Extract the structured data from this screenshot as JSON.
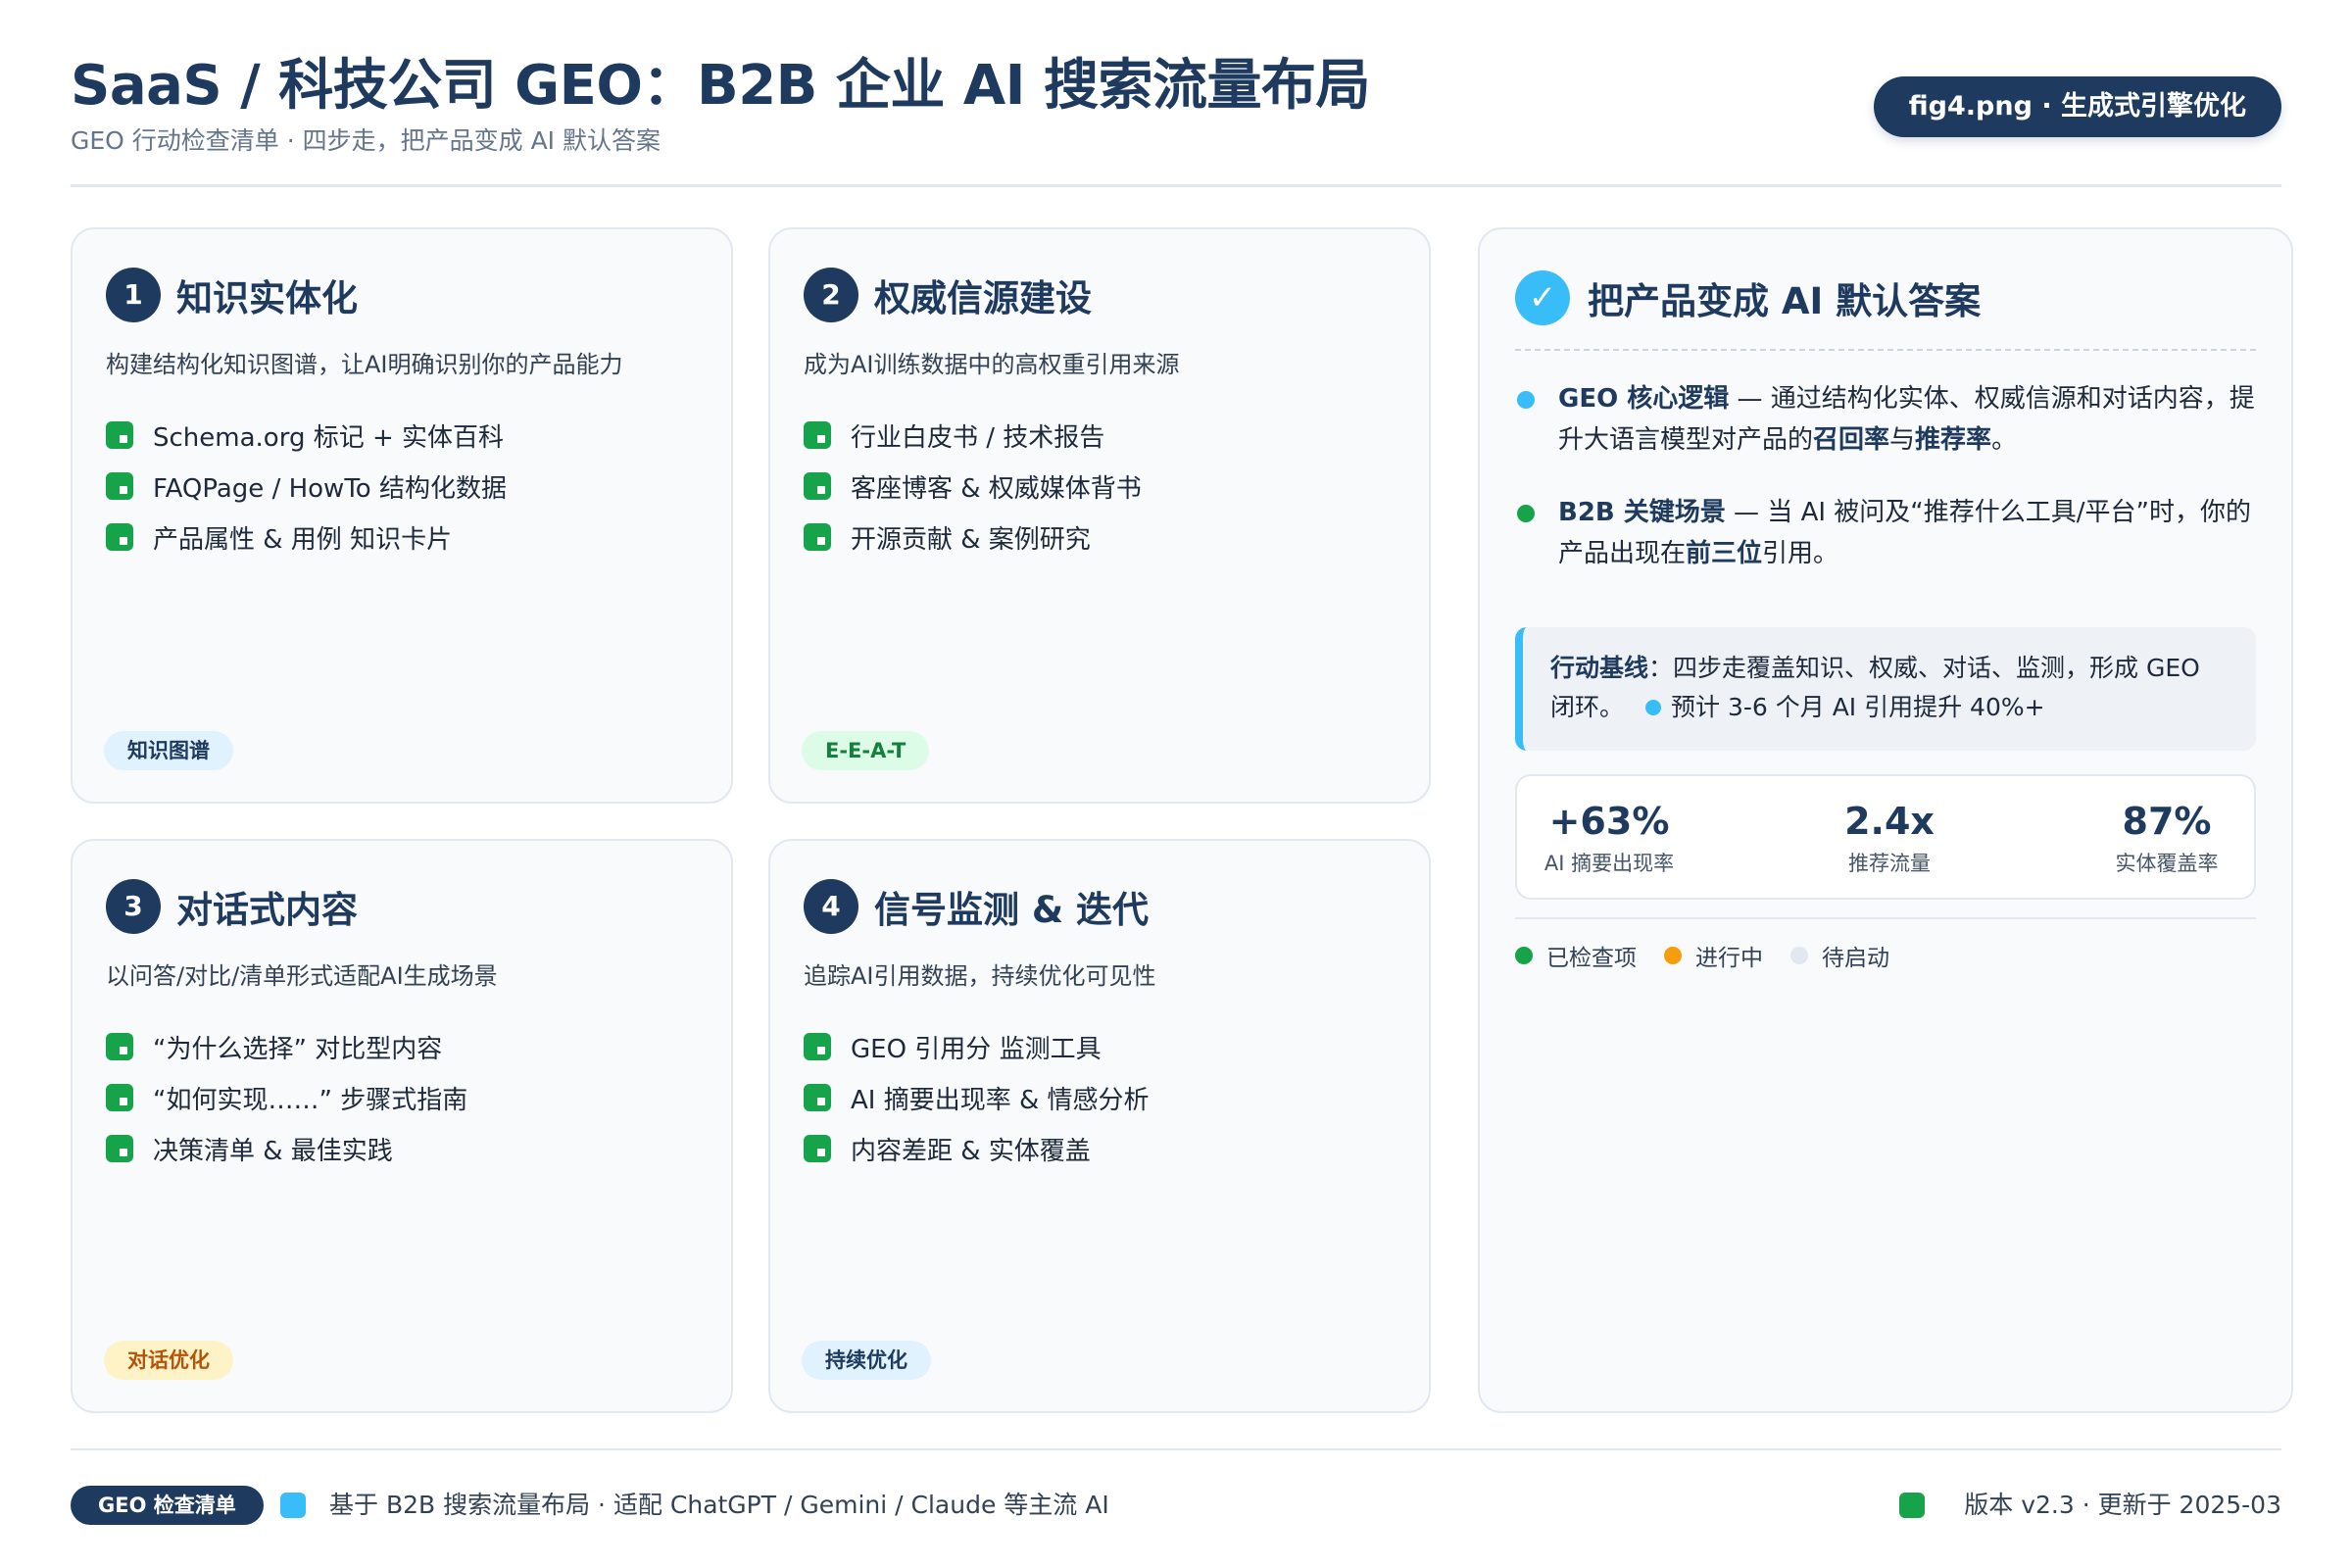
{
  "header": {
    "title": "SaaS / 科技公司 GEO：B2B 企业 AI 搜索流量布局",
    "subtitle": "GEO 行动检查清单 · 四步走，把产品变成 AI 默认答案",
    "badge": "fig4.png · 生成式引擎优化"
  },
  "cards": [
    {
      "number": "1",
      "title": "知识实体化",
      "description": "构建结构化知识图谱，让AI明确识别你的产品能力",
      "items": [
        "Schema.org 标记 + 实体百科",
        "FAQPage / HowTo 结构化数据",
        "产品属性 & 用例 知识卡片"
      ],
      "tag": "知识图谱",
      "tag_bg": "#e0f2fe",
      "tag_color": "#1e3a5f"
    },
    {
      "number": "2",
      "title": "权威信源建设",
      "description": "成为AI训练数据中的高权重引用来源",
      "items": [
        "行业白皮书 / 技术报告",
        "客座博客 & 权威媒体背书",
        "开源贡献 & 案例研究"
      ],
      "tag": "E-E-A-T",
      "tag_bg": "#dcfce7",
      "tag_color": "#15803d"
    },
    {
      "number": "3",
      "title": "对话式内容",
      "description": "以问答/对比/清单形式适配AI生成场景",
      "items": [
        "“为什么选择” 对比型内容",
        "“如何实现……” 步骤式指南",
        "决策清单 & 最佳实践"
      ],
      "tag": "对话优化",
      "tag_bg": "#fef3c7",
      "tag_color": "#b45309"
    },
    {
      "number": "4",
      "title": "信号监测 & 迭代",
      "description": "追踪AI引用数据，持续优化可见性",
      "items": [
        "GEO 引用分 监测工具",
        "AI 摘要出现率 & 情感分析",
        "内容差距 & 实体覆盖"
      ],
      "tag": "持续优化",
      "tag_bg": "#e0f2fe",
      "tag_color": "#1e3a5f"
    }
  ],
  "summary": {
    "check_glyph": "✓",
    "title": "把产品变成 AI 默认答案",
    "bullet1": {
      "label": "GEO 核心逻辑",
      "text_a": " — 通过结构化实体、权威信源和对话内容，提升大语言模型对产品的",
      "em1": "召回率",
      "text_b": "与",
      "em2": "推荐率",
      "text_c": "。"
    },
    "bullet2": {
      "label": "B2B 关键场景",
      "text_a": " — 当 AI 被问及“推荐什么工具/平台”时，你的产品出现在",
      "em1": "前三位",
      "text_b": "引用。"
    },
    "baseline": {
      "label": "行动基线",
      "text": "：四步走覆盖知识、权威、对话、监测，形成 GEO 闭环。",
      "forecast": "预计 3-6 个月 AI 引用提升 40%+"
    },
    "stats": [
      {
        "value": "+63%",
        "label": "AI 摘要出现率"
      },
      {
        "value": "2.4x",
        "label": "推荐流量"
      },
      {
        "value": "87%",
        "label": "实体覆盖率"
      }
    ],
    "legend": [
      {
        "label": "已检查项",
        "color": "#16a34a"
      },
      {
        "label": "进行中",
        "color": "#f59e0b"
      },
      {
        "label": "待启动",
        "color": "#e2e8f0"
      }
    ]
  },
  "footer": {
    "badge": "GEO 检查清单",
    "left_text": "基于 B2B 搜索流量布局 · 适配 ChatGPT / Gemini / Claude 等主流 AI",
    "right_text": "版本 v2.3 · 更新于 2025-03"
  },
  "colors": {
    "navy": "#1e3a5f",
    "sky": "#38bdf8",
    "green": "#16a34a",
    "amber": "#f59e0b"
  }
}
